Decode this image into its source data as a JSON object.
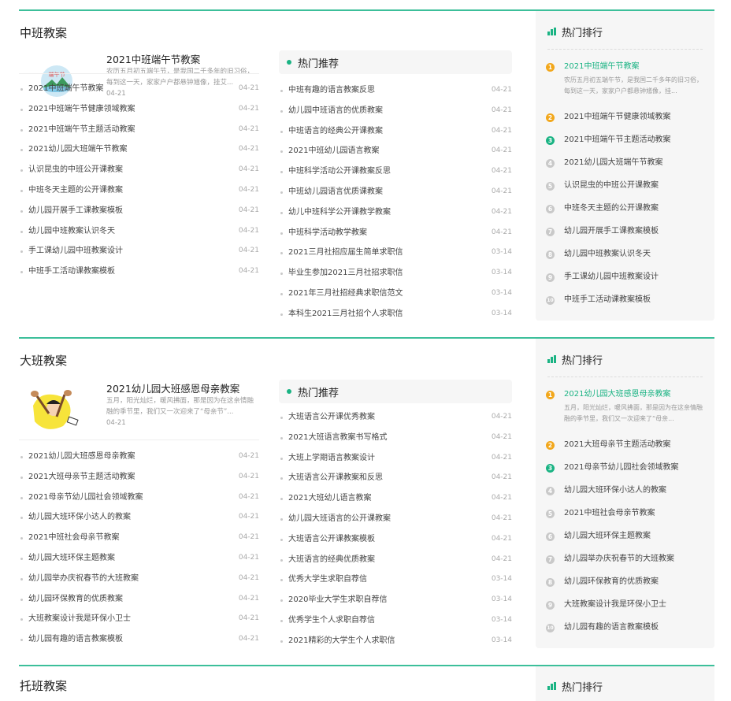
{
  "sections": [
    {
      "title": "中班教案",
      "featured": {
        "title": "2021中班端午节教案",
        "desc": "农历五月初五端午节，是我国二千多年的旧习俗，每到这一天，家家户户都悬钟馗像，挂艾...",
        "date": "04-21",
        "image_label": "端午节"
      },
      "left_list": [
        {
          "t": "2021中班端午节教案",
          "d": "04-21"
        },
        {
          "t": "2021中班端午节健康领域教案",
          "d": "04-21"
        },
        {
          "t": "2021中班端午节主题活动教案",
          "d": "04-21"
        },
        {
          "t": "2021幼儿园大班端午节教案",
          "d": "04-21"
        },
        {
          "t": "认识昆虫的中班公开课教案",
          "d": "04-21"
        },
        {
          "t": "中班冬天主题的公开课教案",
          "d": "04-21"
        },
        {
          "t": "幼儿园开展手工课教案模板",
          "d": "04-21"
        },
        {
          "t": "幼儿园中班教案认识冬天",
          "d": "04-21"
        },
        {
          "t": "手工课幼儿园中班教案设计",
          "d": "04-21"
        },
        {
          "t": "中班手工活动课教案模板",
          "d": "04-21"
        }
      ],
      "hot_label": "热门推荐",
      "mid_list": [
        {
          "t": "中班有趣的语言教案反思",
          "d": "04-21"
        },
        {
          "t": "幼儿园中班语言的优质教案",
          "d": "04-21"
        },
        {
          "t": "中班语言的经典公开课教案",
          "d": "04-21"
        },
        {
          "t": "2021中班幼儿园语言教案",
          "d": "04-21"
        },
        {
          "t": "中班科学活动公开课教案反思",
          "d": "04-21"
        },
        {
          "t": "中班幼儿园语言优质课教案",
          "d": "04-21"
        },
        {
          "t": "幼儿中班科学公开课教学教案",
          "d": "04-21"
        },
        {
          "t": "中班科学活动教学教案",
          "d": "04-21"
        },
        {
          "t": "2021三月社招应届生简单求职信",
          "d": "03-14"
        },
        {
          "t": "毕业生参加2021三月社招求职信",
          "d": "03-14"
        },
        {
          "t": "2021年三月社招经典求职信范文",
          "d": "03-14"
        },
        {
          "t": "本科生2021三月社招个人求职信",
          "d": "03-14"
        }
      ],
      "rank_title": "热门排行",
      "rank": [
        {
          "n": "1",
          "t": "2021中班端午节教案",
          "desc": "农历五月初五端午节，是我国二千多年的旧习俗，每到这一天，家家户户都悬钟馗像，挂..."
        },
        {
          "n": "2",
          "t": "2021中班端午节健康领域教案"
        },
        {
          "n": "3",
          "t": "2021中班端午节主题活动教案"
        },
        {
          "n": "4",
          "t": "2021幼儿园大班端午节教案"
        },
        {
          "n": "5",
          "t": "认识昆虫的中班公开课教案"
        },
        {
          "n": "6",
          "t": "中班冬天主题的公开课教案"
        },
        {
          "n": "7",
          "t": "幼儿园开展手工课教案模板"
        },
        {
          "n": "8",
          "t": "幼儿园中班教案认识冬天"
        },
        {
          "n": "9",
          "t": "手工课幼儿园中班教案设计"
        },
        {
          "n": "10",
          "t": "中班手工活动课教案模板"
        }
      ]
    },
    {
      "title": "大班教案",
      "featured": {
        "title": "2021幼儿园大班感恩母亲教案",
        "desc": "五月，阳光灿烂，暖风拂面，那是因为在这亲情融融的季节里，我们又一次迎来了“母亲节”...",
        "date": "04-21",
        "image_label": ""
      },
      "left_list": [
        {
          "t": "2021幼儿园大班感恩母亲教案",
          "d": "04-21"
        },
        {
          "t": "2021大班母亲节主题活动教案",
          "d": "04-21"
        },
        {
          "t": "2021母亲节幼儿园社会领域教案",
          "d": "04-21"
        },
        {
          "t": "幼儿园大班环保小达人的教案",
          "d": "04-21"
        },
        {
          "t": "2021中班社会母亲节教案",
          "d": "04-21"
        },
        {
          "t": "幼儿园大班环保主题教案",
          "d": "04-21"
        },
        {
          "t": "幼儿园举办庆祝春节的大班教案",
          "d": "04-21"
        },
        {
          "t": "幼儿园环保教育的优质教案",
          "d": "04-21"
        },
        {
          "t": "大班教案设计我是环保小卫士",
          "d": "04-21"
        },
        {
          "t": "幼儿园有趣的语言教案模板",
          "d": "04-21"
        }
      ],
      "hot_label": "热门推荐",
      "mid_list": [
        {
          "t": "大班语言公开课优秀教案",
          "d": "04-21"
        },
        {
          "t": "2021大班语言教案书写格式",
          "d": "04-21"
        },
        {
          "t": "大班上学期语言教案设计",
          "d": "04-21"
        },
        {
          "t": "大班语言公开课教案和反思",
          "d": "04-21"
        },
        {
          "t": "2021大班幼儿语言教案",
          "d": "04-21"
        },
        {
          "t": "幼儿园大班语言的公开课教案",
          "d": "04-21"
        },
        {
          "t": "大班语言公开课教案模板",
          "d": "04-21"
        },
        {
          "t": "大班语言的经典优质教案",
          "d": "04-21"
        },
        {
          "t": "优秀大学生求职自荐信",
          "d": "03-14"
        },
        {
          "t": "2020毕业大学生求职自荐信",
          "d": "03-14"
        },
        {
          "t": "优秀学生个人求职自荐信",
          "d": "03-14"
        },
        {
          "t": "2021精彩的大学生个人求职信",
          "d": "03-14"
        }
      ],
      "rank_title": "热门排行",
      "rank": [
        {
          "n": "1",
          "t": "2021幼儿园大班感恩母亲教案",
          "desc": "五月，阳光灿烂，暖风拂面，那是因为在这亲情融融的季节里，我们又一次迎来了“母亲..."
        },
        {
          "n": "2",
          "t": "2021大班母亲节主题活动教案"
        },
        {
          "n": "3",
          "t": "2021母亲节幼儿园社会领域教案"
        },
        {
          "n": "4",
          "t": "幼儿园大班环保小达人的教案"
        },
        {
          "n": "5",
          "t": "2021中班社会母亲节教案"
        },
        {
          "n": "6",
          "t": "幼儿园大班环保主题教案"
        },
        {
          "n": "7",
          "t": "幼儿园举办庆祝春节的大班教案"
        },
        {
          "n": "8",
          "t": "幼儿园环保教育的优质教案"
        },
        {
          "n": "9",
          "t": "大班教案设计我是环保小卫士"
        },
        {
          "n": "10",
          "t": "幼儿园有趣的语言教案模板"
        }
      ]
    },
    {
      "title": "托班教案",
      "rank_title": "热门排行"
    }
  ],
  "colors": {
    "accent": "#3cbf9a",
    "green": "#1ab383",
    "orange": "#f2a71b",
    "panel": "#f6f6f6"
  }
}
